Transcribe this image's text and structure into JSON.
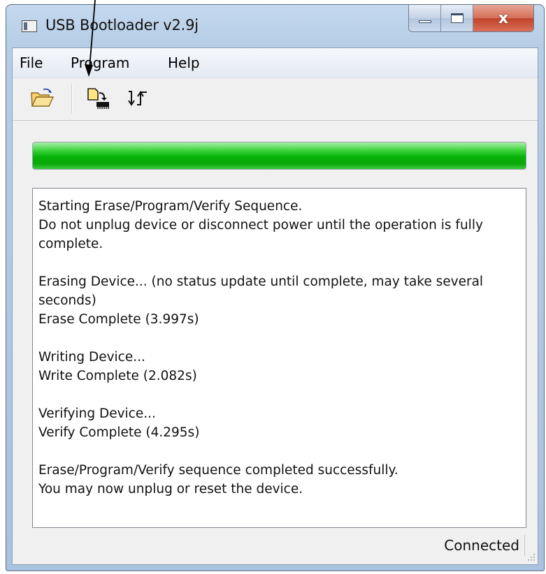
{
  "window": {
    "title": "USB Bootloader v2.9j",
    "close_glyph": "x"
  },
  "menu": {
    "file": "File",
    "program": "Program",
    "help": "Help"
  },
  "toolbar": {
    "icons": [
      "open-folder-icon",
      "write-device-icon",
      "reset-device-icon"
    ]
  },
  "progress": {
    "value": 100,
    "color": "#0aa90a"
  },
  "log": {
    "lines": [
      "Starting Erase/Program/Verify Sequence.",
      "Do not unplug device or disconnect power until the operation is fully",
      "complete.",
      "",
      "Erasing Device... (no status update until complete, may take several",
      "seconds)",
      "Erase Complete (3.997s)",
      "",
      "Writing Device...",
      "Write Complete (2.082s)",
      "",
      "Verifying Device...",
      "Verify Complete (4.295s)",
      "",
      "Erase/Program/Verify sequence completed successfully.",
      "You may now unplug or reset the device."
    ]
  },
  "status": {
    "text": "Connected"
  }
}
